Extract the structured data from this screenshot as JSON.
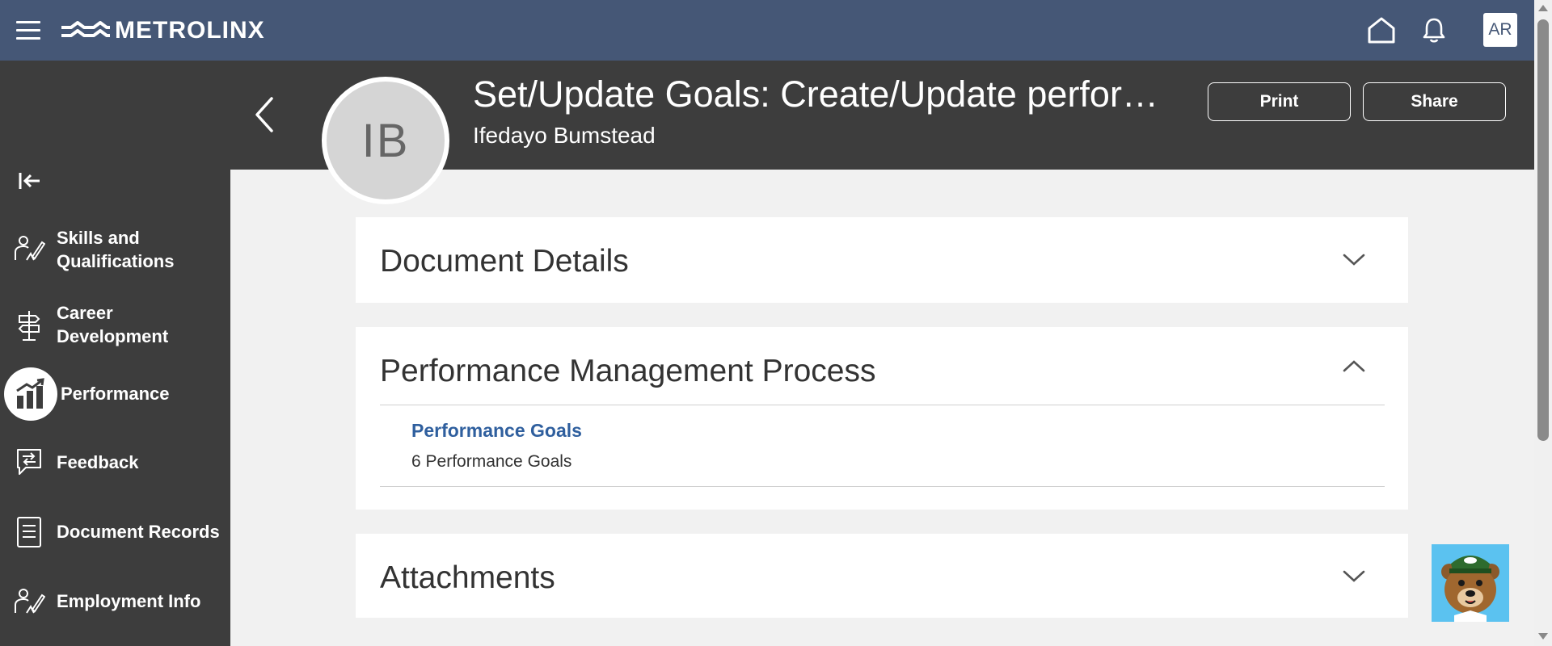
{
  "topbar": {
    "brand": "METROLINX",
    "user_initials": "AR"
  },
  "sidebar": {
    "items": [
      {
        "label_line1": "Skills and",
        "label_line2": "Qualifications"
      },
      {
        "label_line1": "Career",
        "label_line2": "Development"
      },
      {
        "label_line1": "Performance"
      },
      {
        "label_line1": "Feedback"
      },
      {
        "label_line1": "Document Records"
      },
      {
        "label_line1": "Employment Info"
      }
    ]
  },
  "header": {
    "avatar_initials": "IB",
    "title": "Set/Update Goals: Create/Update performan...",
    "subtitle": "Ifedayo Bumstead",
    "print_label": "Print",
    "share_label": "Share"
  },
  "sections": {
    "document_details": {
      "title": "Document Details"
    },
    "pmp": {
      "title": "Performance Management Process",
      "goals_link": "Performance Goals",
      "goals_count": "6 Performance Goals"
    },
    "attachments": {
      "title": "Attachments"
    }
  },
  "colors": {
    "topbar": "#455776",
    "sidebar": "#3d3d3d",
    "link": "#2f5f9e",
    "content_bg": "#f1f1f1"
  },
  "icons": [
    "hamburger-icon",
    "metrolinx-logo-icon",
    "home-icon",
    "bell-icon",
    "collapse-sidebar-icon",
    "back-chevron-icon",
    "chevron-down-icon",
    "chevron-up-icon",
    "mascot-bear-icon"
  ]
}
